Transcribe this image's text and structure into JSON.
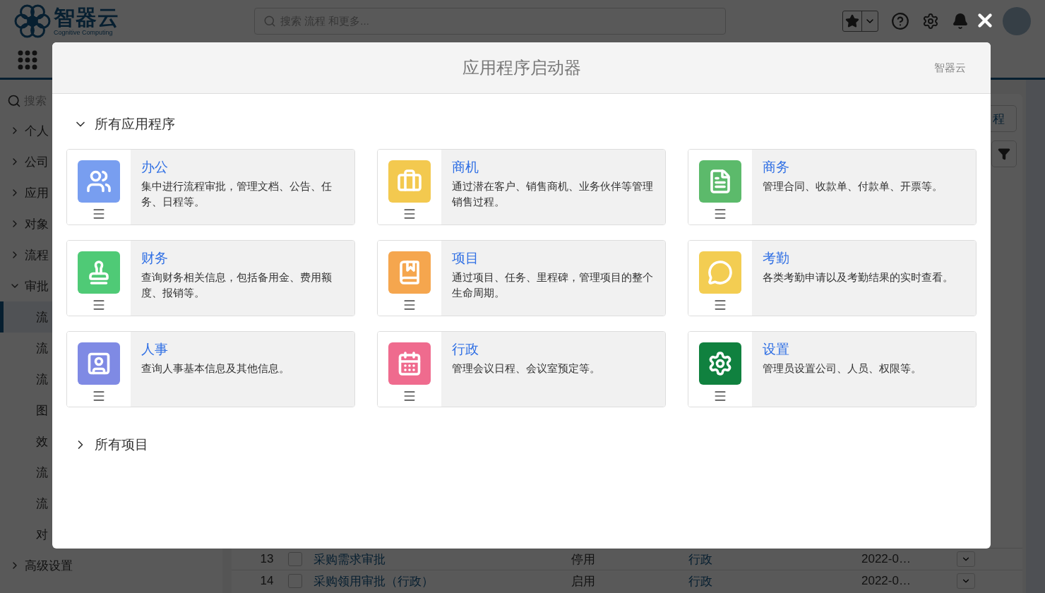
{
  "header": {
    "logo_title": "智器云",
    "logo_subtitle": "Cognitive Computing",
    "search": {
      "placeholder": "搜索 流程 和更多..."
    }
  },
  "sidebar": {
    "search": {
      "placeholder": "搜索"
    },
    "items": [
      {
        "label": "个人",
        "expanded": false
      },
      {
        "label": "公司",
        "expanded": false
      },
      {
        "label": "应用",
        "expanded": false
      },
      {
        "label": "对象",
        "expanded": false
      },
      {
        "label": "流程",
        "expanded": false
      },
      {
        "label": "审批",
        "expanded": true,
        "children": [
          {
            "label": "流",
            "selected": true
          },
          {
            "label": "流",
            "selected": false
          },
          {
            "label": "流",
            "selected": false
          },
          {
            "label": "图",
            "selected": false
          },
          {
            "label": "效",
            "selected": false
          },
          {
            "label": "流",
            "selected": false
          },
          {
            "label": "流",
            "selected": false
          },
          {
            "label": "对",
            "selected": false
          }
        ]
      },
      {
        "label": "高级设置",
        "expanded": false
      }
    ]
  },
  "main": {
    "action_button": "程",
    "table": {
      "rows": [
        {
          "number": "13",
          "checked": false,
          "name": "采购需求审批",
          "status": "停用",
          "category": "行政",
          "date": "2022-0…"
        },
        {
          "number": "14",
          "checked": false,
          "name": "采购领用审批（行政）",
          "status": "启用",
          "category": "行政",
          "date": "2022-0…"
        }
      ]
    }
  },
  "launcher": {
    "title": "应用程序启动器",
    "org": "智器云",
    "sections": [
      {
        "label": "所有应用程序",
        "expanded": true,
        "apps": [
          {
            "name": "办公",
            "description": "集中进行流程审批，管理文档、公告、任务、日程等。",
            "kind": "people",
            "color": "#789ef0"
          },
          {
            "name": "商机",
            "description": "通过潜在客户、销售商机、业务伙伴等管理销售过程。",
            "kind": "briefcase",
            "color": "#f3c94f"
          },
          {
            "name": "商务",
            "description": "管理合同、收款单、付款单、开票等。",
            "kind": "document",
            "color": "#5cba6b"
          },
          {
            "name": "财务",
            "description": "查询财务相关信息，包括备用金、费用额度、报销等。",
            "kind": "stamp",
            "color": "#4fca76"
          },
          {
            "name": "项目",
            "description": "通过项目、任务、里程碑，管理项目的整个生命周期。",
            "kind": "bookmark",
            "color": "#f5a64e"
          },
          {
            "name": "考勤",
            "description": "各类考勤申请以及考勤结果的实时查看。",
            "kind": "chat",
            "color": "#f3cd52"
          },
          {
            "name": "人事",
            "description": "查询人事基本信息及其他信息。",
            "kind": "contact",
            "color": "#7f8ae4"
          },
          {
            "name": "行政",
            "description": "管理会议日程、会议室预定等。",
            "kind": "calendar",
            "color": "#ef6b8e"
          },
          {
            "name": "设置",
            "description": "管理员设置公司、人员、权限等。",
            "kind": "gear",
            "color": "#10813f"
          }
        ]
      },
      {
        "label": "所有项目",
        "expanded": false
      }
    ]
  }
}
